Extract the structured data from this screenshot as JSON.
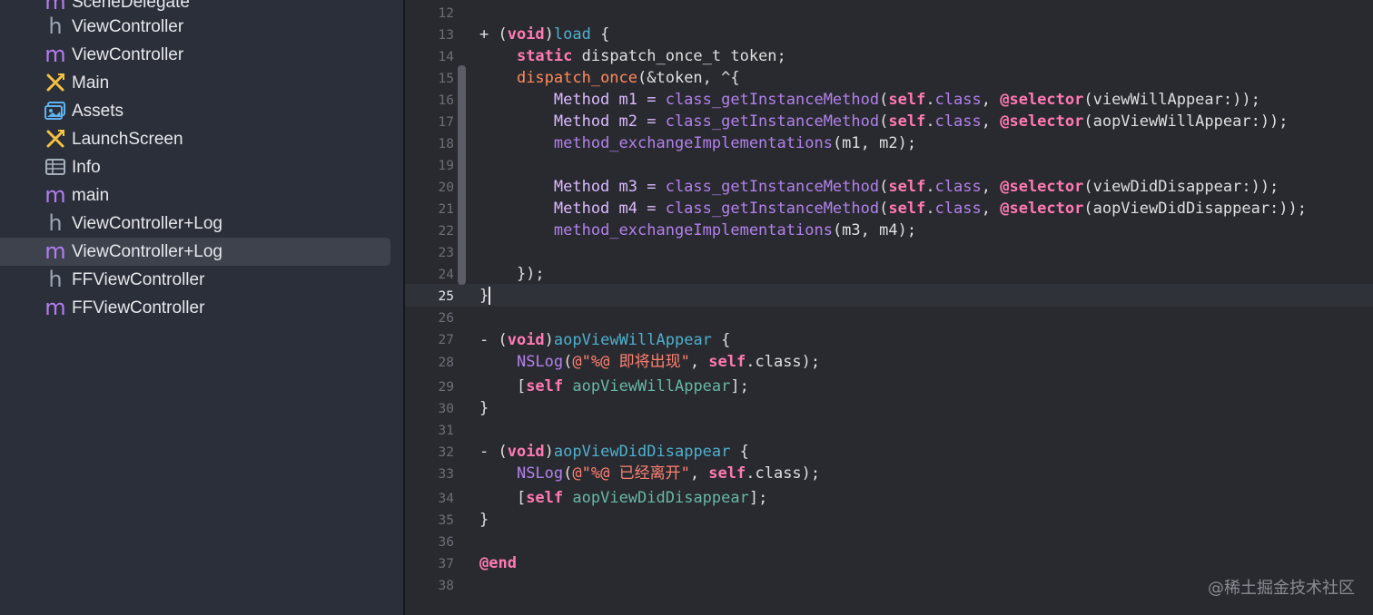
{
  "sidebar": {
    "items": [
      {
        "label": "SceneDelegate",
        "icon": "objc-m-file-icon"
      },
      {
        "label": "ViewController",
        "icon": "header-h-file-icon"
      },
      {
        "label": "ViewController",
        "icon": "objc-m-file-icon"
      },
      {
        "label": "Main",
        "icon": "storyboard-icon"
      },
      {
        "label": "Assets",
        "icon": "asset-catalog-icon"
      },
      {
        "label": "LaunchScreen",
        "icon": "storyboard-icon"
      },
      {
        "label": "Info",
        "icon": "plist-table-icon"
      },
      {
        "label": "main",
        "icon": "objc-m-file-icon"
      },
      {
        "label": "ViewController+Log",
        "icon": "header-h-file-icon"
      },
      {
        "label": "ViewController+Log",
        "icon": "objc-m-file-icon",
        "selected": true
      },
      {
        "label": "FFViewController",
        "icon": "header-h-file-icon"
      },
      {
        "label": "FFViewController",
        "icon": "objc-m-file-icon"
      }
    ]
  },
  "editor": {
    "current_line": "25",
    "line_numbers": [
      "12",
      "13",
      "14",
      "15",
      "16",
      "17",
      "18",
      "19",
      "20",
      "21",
      "22",
      "23",
      "24",
      "25",
      "26",
      "27",
      "28",
      "29",
      "30",
      "31",
      "32",
      "33",
      "34",
      "35",
      "36",
      "37",
      "38"
    ],
    "code": {
      "l13": {
        "a": "+ (",
        "b": "void",
        "c": ")",
        "d": "load",
        "e": " {"
      },
      "l14": {
        "a": "    ",
        "b": "static",
        "c": " dispatch_once_t token;"
      },
      "l15": {
        "a": "    ",
        "b": "dispatch_once",
        "c": "(&token, ^{"
      },
      "l16": {
        "a": "        Method m1 = ",
        "b": "class_getInstanceMethod",
        "c": "(",
        "d": "self",
        "e": ".",
        "f": "class",
        "g": ", ",
        "h": "@selector",
        "i": "(viewWillAppear:));"
      },
      "l17": {
        "a": "        Method m2 = ",
        "b": "class_getInstanceMethod",
        "c": "(",
        "d": "self",
        "e": ".",
        "f": "class",
        "g": ", ",
        "h": "@selector",
        "i": "(aopViewWillAppear:));"
      },
      "l18": {
        "a": "        ",
        "b": "method_exchangeImplementations",
        "c": "(m1, m2);"
      },
      "l20": {
        "a": "        Method m3 = ",
        "b": "class_getInstanceMethod",
        "c": "(",
        "d": "self",
        "e": ".",
        "f": "class",
        "g": ", ",
        "h": "@selector",
        "i": "(viewDidDisappear:));"
      },
      "l21": {
        "a": "        Method m4 = ",
        "b": "class_getInstanceMethod",
        "c": "(",
        "d": "self",
        "e": ".",
        "f": "class",
        "g": ", ",
        "h": "@selector",
        "i": "(aopViewDidDisappear:));"
      },
      "l22": {
        "a": "        ",
        "b": "method_exchangeImplementations",
        "c": "(m3, m4);"
      },
      "l24": {
        "a": "    });"
      },
      "l25": {
        "a": "}"
      },
      "l27": {
        "a": "- (",
        "b": "void",
        "c": ")",
        "d": "aopViewWillAppear",
        "e": " {"
      },
      "l28": {
        "a": "    ",
        "b": "NSLog",
        "c": "(",
        "d": "@\"%@ 即将出现\"",
        "e": ", ",
        "f": "self",
        "g": ".class);"
      },
      "l29": {
        "a": "    [",
        "b": "self",
        "c": " ",
        "d": "aopViewWillAppear",
        "e": "];"
      },
      "l30": {
        "a": "}"
      },
      "l32": {
        "a": "- (",
        "b": "void",
        "c": ")",
        "d": "aopViewDidDisappear",
        "e": " {"
      },
      "l33": {
        "a": "    ",
        "b": "NSLog",
        "c": "(",
        "d": "@\"%@ 已经离开\"",
        "e": ", ",
        "f": "self",
        "g": ".class);"
      },
      "l34": {
        "a": "    [",
        "b": "self",
        "c": " ",
        "d": "aopViewDidDisappear",
        "e": "];"
      },
      "l35": {
        "a": "}"
      },
      "l37": {
        "a": "@end"
      }
    }
  },
  "watermark": "@稀土掘金技术社区",
  "colors": {
    "background": "#292a30",
    "sidebar_background": "#2b2f39",
    "keyword": "#ff7ab2",
    "declaration": "#4eb0cc",
    "plain_function": "#b281eb",
    "string": "#ff8170",
    "self_method": "#67b7a4"
  }
}
